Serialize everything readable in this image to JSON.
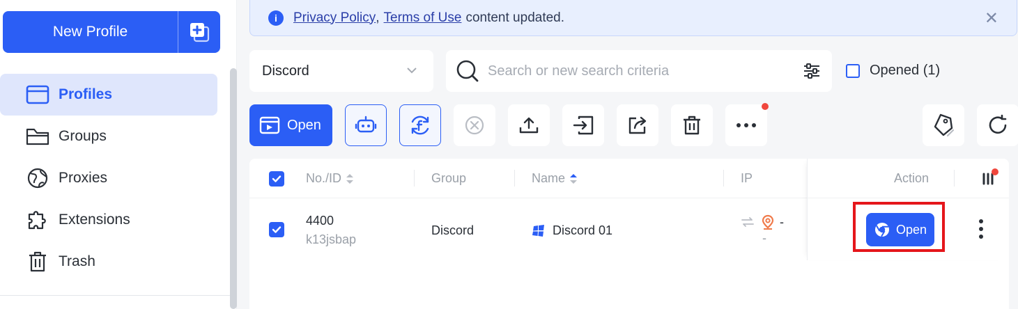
{
  "sidebar": {
    "new_profile_label": "New Profile",
    "items": [
      {
        "label": "Profiles",
        "icon": "browser-window-icon",
        "active": true
      },
      {
        "label": "Groups",
        "icon": "folder-icon"
      },
      {
        "label": "Proxies",
        "icon": "globe-icon"
      },
      {
        "label": "Extensions",
        "icon": "puzzle-icon"
      },
      {
        "label": "Trash",
        "icon": "trash-icon"
      }
    ]
  },
  "banner": {
    "link1": "Privacy Policy",
    "separator": ",",
    "link2": "Terms of Use",
    "text": "content updated.",
    "info_glyph": "i",
    "close_glyph": "✕"
  },
  "filters": {
    "group_value": "Discord",
    "search_placeholder": "Search or new search criteria",
    "opened_label": "Opened (1)"
  },
  "toolbar": {
    "open_label": "Open"
  },
  "table": {
    "headers": {
      "no_id": "No./ID",
      "group": "Group",
      "name": "Name",
      "ip": "IP",
      "action": "Action"
    },
    "rows": [
      {
        "number": "4400",
        "id": "k13jsbap",
        "group": "Discord",
        "name": "Discord 01",
        "ip_line1": "-",
        "ip_line2": "-",
        "open_label": "Open"
      }
    ]
  },
  "colors": {
    "accent": "#2b5ef5",
    "highlight": "#e5161b",
    "notification": "#f0473d"
  }
}
